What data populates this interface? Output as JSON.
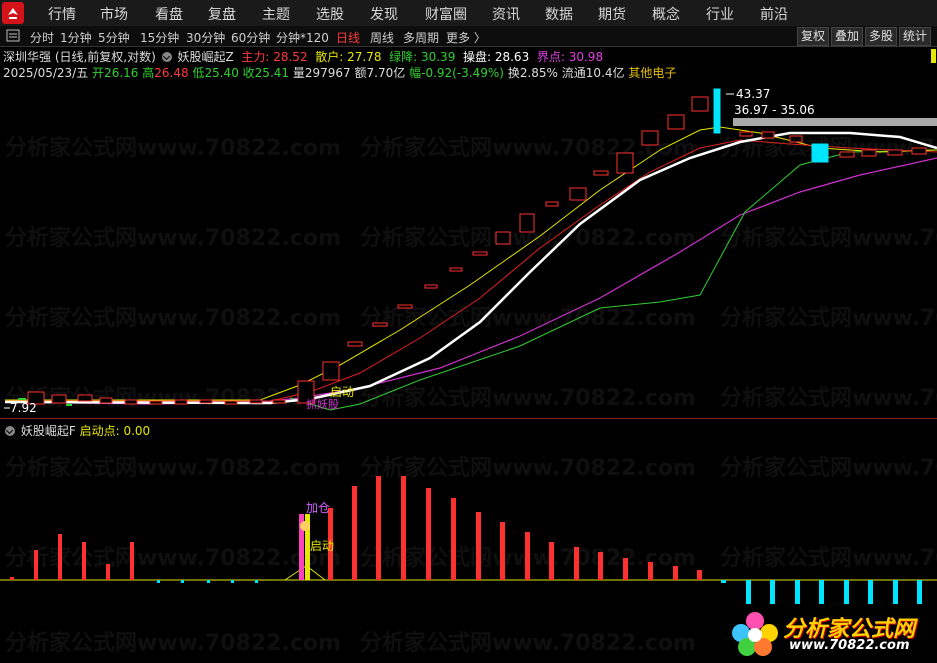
{
  "topbar": {
    "menu": [
      "行情",
      "市场",
      "看盘",
      "复盘",
      "主题",
      "选股",
      "发现",
      "财富圈",
      "资讯",
      "数据",
      "期货",
      "概念",
      "行业",
      "前沿"
    ]
  },
  "periods": {
    "items": [
      "分时",
      "1分钟",
      "5分钟",
      "15分钟",
      "30分钟",
      "60分钟",
      "分钟*120",
      "日线",
      "周线",
      "多周期",
      "更多 〉"
    ],
    "active": "日线"
  },
  "right_buttons": [
    "复权",
    "叠加",
    "多股",
    "统计"
  ],
  "info1": {
    "stock": "深圳华强 (日线,前复权,对数)",
    "indicator": "妖股崛起Z",
    "zhuli_label": "主力:",
    "zhuli": "28.52",
    "sanhu_label": "散户:",
    "sanhu": "27.78",
    "lvjiang_label": "绿降:",
    "lvjiang": "30.39",
    "caopan_label": "操盘:",
    "caopan": "28.63",
    "jiedian_label": "界点:",
    "jiedian": "30.98"
  },
  "info2": {
    "date": "2025/05/23/五",
    "open_label": "开",
    "open": "26.16",
    "high_label": "高",
    "high": "26.48",
    "low_label": "低",
    "low": "25.40",
    "close_label": "收",
    "close": "25.41",
    "vol_label": "量",
    "vol": "297967",
    "amt_label": "额",
    "amt": "7.70亿",
    "chg_label": "幅",
    "chg": "-0.92(-3.49%)",
    "turn_label": "换",
    "turn": "2.85%",
    "float_label": "流通",
    "float": "10.4亿",
    "sector": "其他电子"
  },
  "main_annotations": {
    "high_price": "43.37",
    "range": "36.97 - 35.06",
    "low_price": "7.92",
    "start_label": "启动",
    "sub_label": "抓妖股"
  },
  "sub_info": {
    "indicator": "妖股崛起F",
    "qidong_label": "启动点:",
    "qidong": "0.00"
  },
  "sub_annotations": {
    "jiacang": "加仓",
    "qidong": "启动"
  },
  "watermark": {
    "text": "分析家公式网www.70822.com"
  },
  "brand": {
    "name": "分析家公式网",
    "url": "www.70822.com"
  },
  "colors": {
    "up": "#ff3030",
    "down": "#00e5ff",
    "white_line": "#ffffff",
    "yellow_line": "#e6e600",
    "magenta_line": "#d030d0",
    "green_line": "#30d030"
  },
  "chart_data": {
    "type": "candlestick",
    "description_values": {
      "price_high": 43.37,
      "price_low": 7.92,
      "start_to_end_move": "7.92 → 43.37"
    },
    "sub_bars": {
      "red": [
        2,
        33,
        48,
        46,
        38,
        18,
        40,
        0,
        0,
        0,
        0,
        0,
        0,
        0,
        0,
        0,
        0,
        0,
        0,
        0,
        0,
        0,
        0,
        0,
        0,
        0,
        0,
        0,
        0,
        0,
        0,
        0,
        0,
        0,
        0,
        0,
        0,
        0,
        0,
        0,
        0,
        0,
        0,
        0,
        0,
        0,
        0,
        0
      ],
      "main_red": [
        100,
        98,
        103,
        103,
        93,
        87,
        75,
        72,
        62,
        50,
        42,
        35,
        25,
        15,
        13
      ],
      "cyan": [
        22,
        22,
        22,
        22,
        22,
        22,
        22,
        22
      ]
    }
  }
}
